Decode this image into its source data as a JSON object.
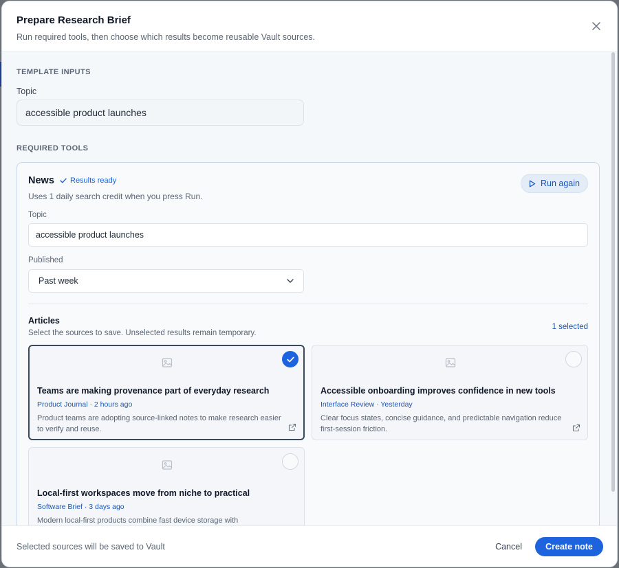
{
  "dialog": {
    "title": "Prepare Research Brief",
    "subtitle": "Run required tools, then choose which results become reusable Vault sources."
  },
  "template_inputs": {
    "section_label": "TEMPLATE INPUTS",
    "topic_label": "Topic",
    "topic_value": "accessible product launches"
  },
  "required_tools": {
    "section_label": "REQUIRED TOOLS",
    "tool": {
      "name": "News",
      "status": "Results ready",
      "description": "Uses 1 daily search credit when you press Run.",
      "run_button": "Run again",
      "topic_label": "Topic",
      "topic_value": "accessible product launches",
      "published_label": "Published",
      "published_value": "Past week",
      "articles_title": "Articles",
      "articles_desc": "Select the sources to save. Unselected results remain temporary.",
      "selected_count": "1 selected",
      "articles": [
        {
          "title": "Teams are making provenance part of everyday research",
          "meta": "Product Journal · 2 hours ago",
          "excerpt": "Product teams are adopting source-linked notes to make research easier to verify and reuse.",
          "selected": true
        },
        {
          "title": "Accessible onboarding improves confidence in new tools",
          "meta": "Interface Review · Yesterday",
          "excerpt": "Clear focus states, concise guidance, and predictable navigation reduce first-session friction.",
          "selected": false
        },
        {
          "title": "Local-first workspaces move from niche to practical",
          "meta": "Software Brief · 3 days ago",
          "excerpt": "Modern local-first products combine fast device storage with",
          "selected": false
        }
      ]
    }
  },
  "footer": {
    "note": "Selected sources will be saved to Vault",
    "cancel": "Cancel",
    "create": "Create note"
  },
  "colors": {
    "accent": "#1d63dd",
    "link": "#1a56b8",
    "body_bg": "#f5f8fb"
  }
}
